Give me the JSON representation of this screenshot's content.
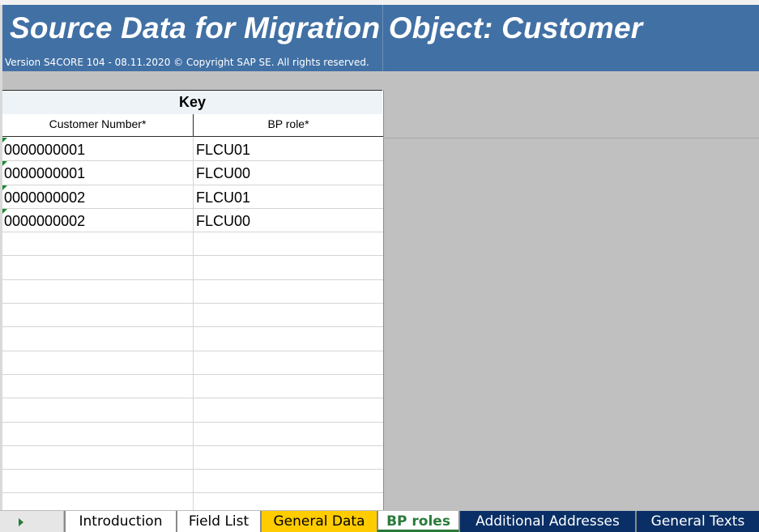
{
  "banner": {
    "title": "Source Data for Migration Object:  Customer",
    "version": "Version S4CORE 104  - 08.11.2020 © Copyright SAP SE. All rights reserved."
  },
  "table": {
    "group_header": "Key",
    "columns": [
      "Customer Number*",
      "BP role*"
    ],
    "rows": [
      [
        "0000000001",
        "FLCU01"
      ],
      [
        "0000000001",
        "FLCU00"
      ],
      [
        "0000000002",
        "FLCU01"
      ],
      [
        "0000000002",
        "FLCU00"
      ]
    ],
    "empty_rows": 12
  },
  "tabs": [
    {
      "label": "Introduction"
    },
    {
      "label": "Field List"
    },
    {
      "label": "General Data"
    },
    {
      "label": "BP roles"
    },
    {
      "label": "Additional Addresses"
    },
    {
      "label": "General Texts"
    }
  ],
  "colors": {
    "banner": "#4170a4",
    "active_tab_text": "#2a7a3a",
    "general_data_tab": "#ffcc00",
    "dark_tab": "#0a2f66"
  },
  "icons": {
    "sheet_nav": "triangle-right-icon",
    "cell_marker": "green-corner-triangle-icon"
  }
}
